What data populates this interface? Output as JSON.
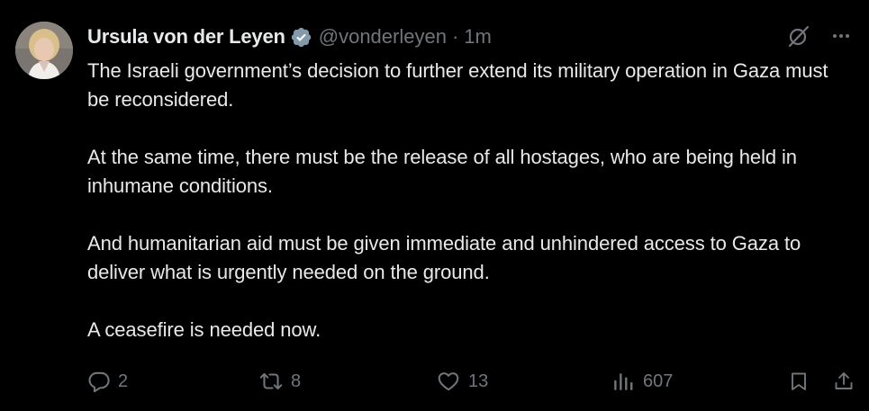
{
  "author": {
    "display_name": "Ursula von der Leyen",
    "handle": "@vonderleyen",
    "separator": "·",
    "timestamp": "1m",
    "verified_icon": "verified-badge-icon"
  },
  "tweet": {
    "paragraphs": [
      "The Israeli government’s decision to further extend its military operation in Gaza must be reconsidered.",
      "At the same time, there must be the release of all hostages, who are being held in inhumane conditions.",
      "And humanitarian aid must be given immediate and unhindered access to Gaza to deliver what is urgently needed on the ground.",
      "A ceasefire is needed now."
    ]
  },
  "actions": {
    "replies": "2",
    "reposts": "8",
    "likes": "13",
    "views": "607"
  },
  "icons": {
    "top_right": [
      "grok-icon",
      "more-options-icon"
    ],
    "action_bar": [
      "reply-icon",
      "repost-icon",
      "like-icon",
      "views-icon",
      "bookmark-icon",
      "share-icon"
    ]
  },
  "colors": {
    "background": "#000000",
    "primary_text": "#e7e9ea",
    "secondary_text": "#71767b",
    "verified_badge": "#829aab"
  }
}
